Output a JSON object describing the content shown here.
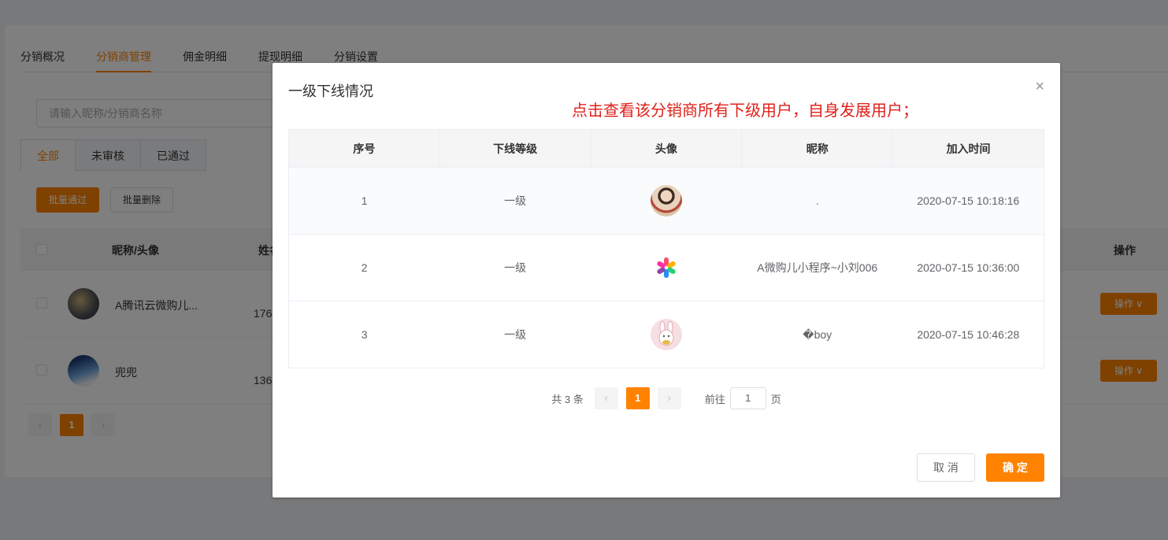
{
  "background": {
    "tabs": [
      "分销概况",
      "分销商管理",
      "佣金明细",
      "提现明细",
      "分销设置"
    ],
    "search_placeholder": "请输入昵称/分销商名称",
    "subtabs": [
      "全部",
      "未审核",
      "已通过"
    ],
    "batch_pass": "批量通过",
    "batch_delete": "批量删除",
    "table_headers": {
      "nickname_avatar": "昵称/头像",
      "name_partial": "姓名",
      "operation": "操作"
    },
    "rows": [
      {
        "nickname": "A腾讯云微购儿...",
        "phone_partial": "176",
        "op": "操作 ∨"
      },
      {
        "nickname": "兜兜",
        "phone_partial": "136",
        "op": "操作 ∨"
      }
    ],
    "pager": {
      "prev": "‹",
      "current": "1",
      "next": "›"
    }
  },
  "dialog": {
    "title": "一级下线情况",
    "close": "×",
    "annotation": "点击查看该分销商所有下级用户，自身发展用户；",
    "columns": [
      "序号",
      "下线等级",
      "头像",
      "昵称",
      "加入时间"
    ],
    "rows": [
      {
        "index": "1",
        "level": "一级",
        "avatar": "portrait-avatar",
        "nickname": ".",
        "joined": "2020-07-15 10:18:16"
      },
      {
        "index": "2",
        "level": "一级",
        "avatar": "colorful-logo-avatar",
        "nickname": "A微购儿小程序~小刘006",
        "joined": "2020-07-15 10:36:00"
      },
      {
        "index": "3",
        "level": "一级",
        "avatar": "bunny-avatar",
        "nickname": "�‍boy",
        "joined": "2020-07-15 10:46:28"
      }
    ],
    "pager": {
      "total": "共 3 条",
      "prev": "‹",
      "current": "1",
      "next": "›",
      "goto": "前往",
      "goto_value": "1",
      "page_unit": "页"
    },
    "cancel": "取 消",
    "confirm": "确 定"
  },
  "colors": {
    "accent": "#ff8200",
    "annotation": "#e0201a",
    "overlay": "rgba(0,0,0,0.5)"
  }
}
